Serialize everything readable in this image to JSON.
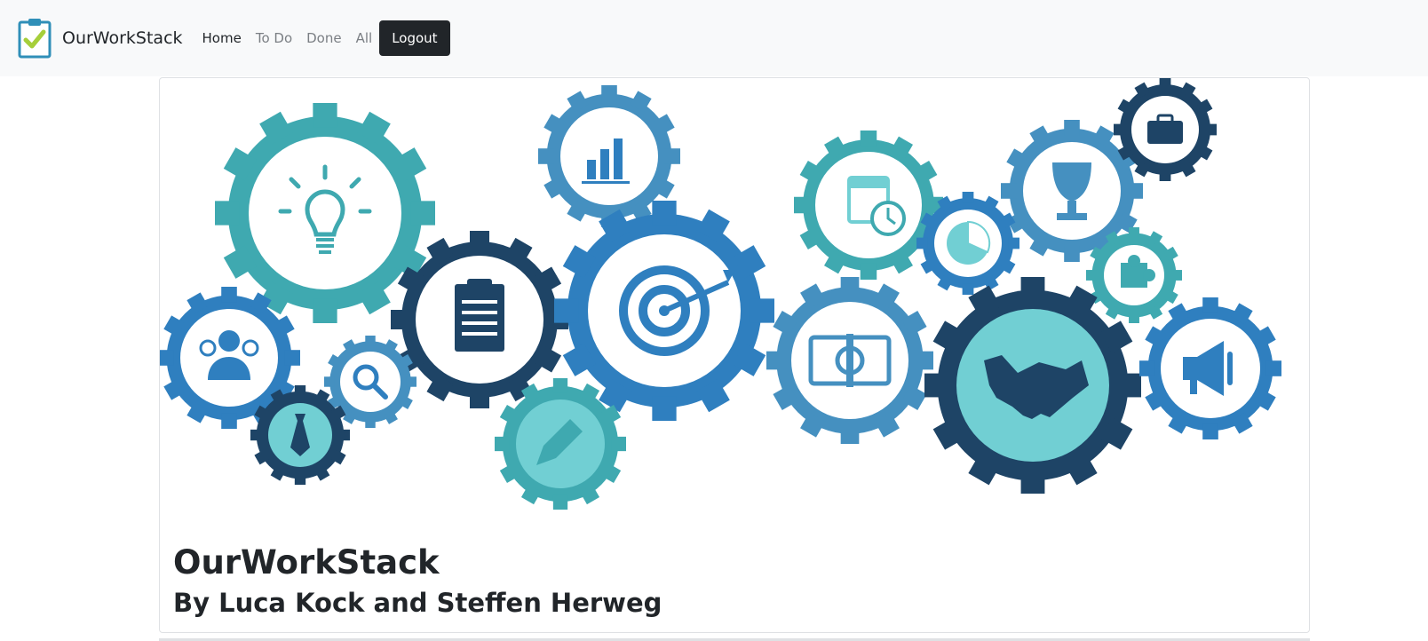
{
  "app": {
    "brand": "OurWorkStack"
  },
  "nav": {
    "items": [
      {
        "label": "Home",
        "active": true
      },
      {
        "label": "To Do",
        "active": false
      },
      {
        "label": "Done",
        "active": false
      },
      {
        "label": "All",
        "active": false
      }
    ],
    "logout_label": "Logout"
  },
  "hero": {
    "title": "OurWorkStack",
    "subtitle": "By Luca Kock and Steffen Herweg",
    "illustration_icons": [
      "lightbulb-icon",
      "bar-chart-icon",
      "calendar-clock-icon",
      "trophy-icon",
      "briefcase-icon",
      "team-icon",
      "clipboard-icon",
      "target-icon",
      "pie-chart-icon",
      "puzzle-icon",
      "search-icon",
      "tie-icon",
      "pencil-icon",
      "money-icon",
      "handshake-icon",
      "megaphone-icon"
    ]
  },
  "colors": {
    "teal": "#3fa9b0",
    "light_teal": "#71cfd3",
    "blue": "#2f7fbf",
    "mid_blue": "#4590c0",
    "navy": "#1e4466",
    "dark_button": "#212529",
    "navbar_bg": "#f8f9fa"
  }
}
